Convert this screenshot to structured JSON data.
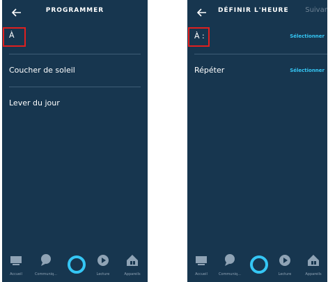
{
  "left": {
    "title": "PROGRAMMER",
    "at_label": "À",
    "options": [
      "Coucher de soleil",
      "Lever du jour"
    ]
  },
  "right": {
    "title": "DÉFINIR L'HEURE",
    "next_label": "Suivant",
    "at_label": "À :",
    "repeat_label": "Répéter",
    "select_label": "Sélectionner"
  },
  "tabs": {
    "home": "Accueil",
    "communicate": "Communiq...",
    "play": "Lecture",
    "devices": "Appareils"
  },
  "colors": {
    "background": "#17364f",
    "accent": "#35c6f4",
    "highlight": "#e0201f",
    "muted": "#6e8294"
  },
  "icons": [
    "back-arrow-icon",
    "home-icon",
    "chat-icon",
    "alexa-icon",
    "play-icon",
    "devices-icon"
  ]
}
